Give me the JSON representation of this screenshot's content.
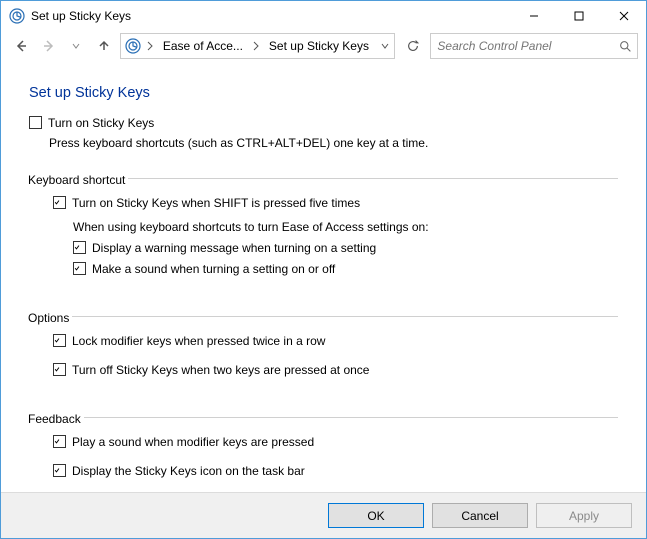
{
  "window": {
    "title": "Set up Sticky Keys"
  },
  "breadcrumb": {
    "seg1": "Ease of Acce...",
    "seg2": "Set up Sticky Keys"
  },
  "search": {
    "placeholder": "Search Control Panel"
  },
  "heading": "Set up Sticky Keys",
  "main_checkbox": {
    "label": "Turn on Sticky Keys",
    "checked": false,
    "desc": "Press keyboard shortcuts (such as CTRL+ALT+DEL) one key at a time."
  },
  "groups": {
    "shortcut": {
      "legend": "Keyboard shortcut",
      "item1": {
        "label": "Turn on Sticky Keys when SHIFT is pressed five times",
        "checked": true
      },
      "note": "When using keyboard shortcuts to turn Ease of Access settings on:",
      "item2": {
        "label": "Display a warning message when turning on a setting",
        "checked": true
      },
      "item3": {
        "label": "Make a sound when turning a setting on or off",
        "checked": true
      }
    },
    "options": {
      "legend": "Options",
      "item1": {
        "label": "Lock modifier keys when pressed twice in a row",
        "checked": true
      },
      "item2": {
        "label": "Turn off Sticky Keys when two keys are pressed at once",
        "checked": true
      }
    },
    "feedback": {
      "legend": "Feedback",
      "item1": {
        "label": "Play a sound when modifier keys are pressed",
        "checked": true
      },
      "item2": {
        "label": "Display the Sticky Keys icon on the task bar",
        "checked": true
      }
    }
  },
  "buttons": {
    "ok": "OK",
    "cancel": "Cancel",
    "apply": "Apply"
  }
}
